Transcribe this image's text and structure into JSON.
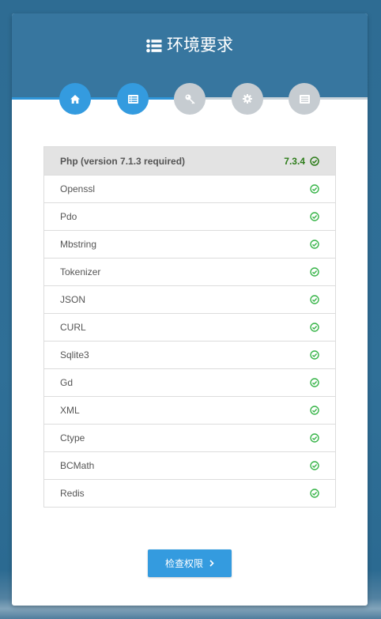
{
  "header": {
    "title": "环境要求",
    "icon": "list-icon"
  },
  "steps": [
    {
      "icon": "home-icon",
      "active": true
    },
    {
      "icon": "list-icon",
      "active": true
    },
    {
      "icon": "key-icon",
      "active": false
    },
    {
      "icon": "gear-icon",
      "active": false
    },
    {
      "icon": "server-icon",
      "active": false
    }
  ],
  "requirements": {
    "php": {
      "label": "Php (version 7.1.3 required)",
      "version": "7.3.4",
      "status": "check-circle-icon"
    },
    "extensions": [
      {
        "label": "Openssl",
        "status": "check-circle-icon"
      },
      {
        "label": "Pdo",
        "status": "check-circle-icon"
      },
      {
        "label": "Mbstring",
        "status": "check-circle-icon"
      },
      {
        "label": "Tokenizer",
        "status": "check-circle-icon"
      },
      {
        "label": "JSON",
        "status": "check-circle-icon"
      },
      {
        "label": "CURL",
        "status": "check-circle-icon"
      },
      {
        "label": "Sqlite3",
        "status": "check-circle-icon"
      },
      {
        "label": "Gd",
        "status": "check-circle-icon"
      },
      {
        "label": "XML",
        "status": "check-circle-icon"
      },
      {
        "label": "Ctype",
        "status": "check-circle-icon"
      },
      {
        "label": "BCMath",
        "status": "check-circle-icon"
      },
      {
        "label": "Redis",
        "status": "check-circle-icon"
      }
    ]
  },
  "next_button": {
    "label": "检查权限",
    "icon": "chevron-right-icon"
  },
  "colors": {
    "background": "#2f6f97",
    "header": "#37769f",
    "accent": "#349bdf",
    "inactive_step": "#c6ccd1",
    "ok": "#39b54a",
    "version": "#2e7d1b"
  }
}
